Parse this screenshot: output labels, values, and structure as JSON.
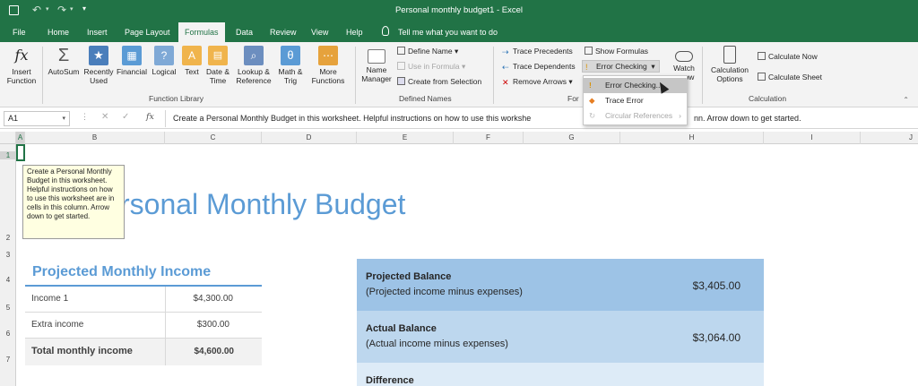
{
  "window": {
    "title": "Personal monthly budget1  -  Excel"
  },
  "tabs": [
    "File",
    "Home",
    "Insert",
    "Page Layout",
    "Formulas",
    "Data",
    "Review",
    "View",
    "Help"
  ],
  "active_tab": "Formulas",
  "tell_me": "Tell me what you want to do",
  "ribbon": {
    "insert_function": [
      "Insert",
      "Function"
    ],
    "lib_buttons": [
      [
        "AutoSum",
        ""
      ],
      [
        "Recently",
        "Used"
      ],
      [
        "Financial",
        ""
      ],
      [
        "Logical",
        ""
      ],
      [
        "Text",
        ""
      ],
      [
        "Date &",
        "Time"
      ],
      [
        "Lookup &",
        "Reference"
      ],
      [
        "Math &",
        "Trig"
      ],
      [
        "More",
        "Functions"
      ]
    ],
    "name_manager": [
      "Name",
      "Manager"
    ],
    "define_name": "Define Name",
    "use_in_formula": "Use in Formula",
    "create_from_selection": "Create from Selection",
    "trace_precedents": "Trace Precedents",
    "trace_dependents": "Trace Dependents",
    "remove_arrows": "Remove Arrows",
    "show_formulas": "Show Formulas",
    "error_checking": "Error Checking",
    "watch": [
      "Watch",
      "ow"
    ],
    "calc_options": [
      "Calculation",
      "Options"
    ],
    "calc_now": "Calculate Now",
    "calc_sheet": "Calculate Sheet",
    "groups": {
      "function_library": "Function Library",
      "defined_names": "Defined Names",
      "formula_auditing": "For",
      "calculation": "Calculation"
    }
  },
  "menu": {
    "items": [
      "Error Checking...",
      "Trace Error",
      "Circular References"
    ]
  },
  "formula_bar": {
    "name_box": "A1",
    "fx": "fx",
    "content": "Create a Personal Monthly Budget in this worksheet. Helpful instructions on how to use this workshe",
    "content_tail": "nn. Arrow down to get started."
  },
  "columns": [
    "A",
    "B",
    "C",
    "D",
    "E",
    "F",
    "G",
    "H",
    "I",
    "J"
  ],
  "rows": [
    "1",
    "2",
    "3",
    "4",
    "5",
    "6",
    "7"
  ],
  "tooltip": "Create a Personal Monthly Budget in this worksheet. Helpful instructions on how to use this worksheet are in cells in this column. Arrow down to get started.",
  "sheet": {
    "title": "rsonal Monthly Budget",
    "income_heading": "Projected Monthly Income",
    "income_rows": [
      {
        "label": "Income 1",
        "value": "$4,300.00"
      },
      {
        "label": "Extra income",
        "value": "$300.00"
      }
    ],
    "total": {
      "label": "Total monthly income",
      "value": "$4,600.00"
    },
    "balances": [
      {
        "title": "Projected Balance",
        "sub": "(Projected income minus expenses)",
        "value": "$3,405.00"
      },
      {
        "title": "Actual Balance",
        "sub": "(Actual income minus expenses)",
        "value": "$3,064.00"
      },
      {
        "title": "Difference",
        "sub": "",
        "value": ""
      }
    ]
  },
  "colors": {
    "excel_green": "#217346",
    "title_blue": "#5b9bd5",
    "balance_dark": "#9dc3e6",
    "balance_mid": "#bdd7ee",
    "balance_light": "#ddebf7"
  }
}
